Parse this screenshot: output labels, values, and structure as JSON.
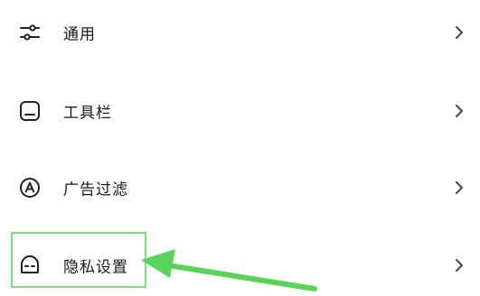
{
  "settings_menu": {
    "items": [
      {
        "label": "通用",
        "icon": "sliders-icon"
      },
      {
        "label": "工具栏",
        "icon": "toolbar-icon"
      },
      {
        "label": "广告过滤",
        "icon": "ad-filter-icon"
      },
      {
        "label": "隐私设置",
        "icon": "privacy-face-icon"
      }
    ],
    "chevron": "›"
  },
  "annotation": {
    "highlight_color": "#7ee07a",
    "arrow_color": "#5ad35a",
    "highlighted_item": "隐私设置"
  }
}
